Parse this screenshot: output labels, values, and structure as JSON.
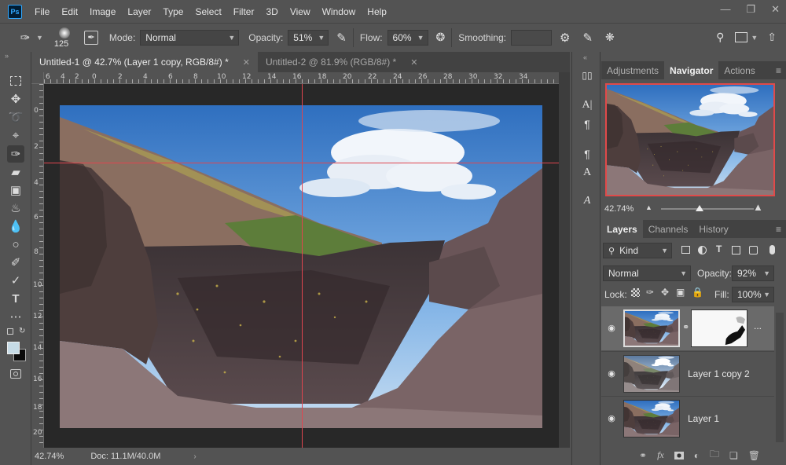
{
  "app": {
    "logo": "Ps"
  },
  "menu": [
    "File",
    "Edit",
    "Image",
    "Layer",
    "Type",
    "Select",
    "Filter",
    "3D",
    "View",
    "Window",
    "Help"
  ],
  "window_controls": [
    "minimize-icon",
    "restore-icon",
    "close-icon"
  ],
  "options": {
    "brush_size": "125",
    "mode_label": "Mode:",
    "mode_value": "Normal",
    "opacity_label": "Opacity:",
    "opacity_value": "51%",
    "flow_label": "Flow:",
    "flow_value": "60%",
    "smoothing_label": "Smoothing:",
    "smoothing_value": ""
  },
  "documents": {
    "tabs": [
      {
        "label": "Untitled-1 @ 42.7% (Layer 1 copy, RGB/8#) *",
        "active": true
      },
      {
        "label": "Untitled-2 @ 81.9% (RGB/8#) *",
        "active": false
      }
    ]
  },
  "rulers": {
    "top": [
      "6",
      "4",
      "2",
      "0",
      "2",
      "4",
      "6",
      "8",
      "10",
      "12",
      "14",
      "16",
      "18",
      "20",
      "22",
      "24",
      "26",
      "28",
      "30",
      "32",
      "34"
    ],
    "left": [
      "0",
      "2",
      "4",
      "6",
      "8",
      "10",
      "12",
      "14",
      "16",
      "18",
      "20"
    ]
  },
  "status": {
    "zoom": "42.74%",
    "doc": "Doc: 11.1M/40.0M"
  },
  "panels": {
    "top_tabs": [
      "Adjustments",
      "Navigator",
      "Actions"
    ],
    "navigator": {
      "zoom": "42.74%"
    },
    "layers_tabs": [
      "Layers",
      "Channels",
      "History"
    ],
    "kind_filter": "Kind",
    "blend_mode": "Normal",
    "opacity_label": "Opacity:",
    "opacity_value": "92%",
    "lock_label": "Lock:",
    "fill_label": "Fill:",
    "fill_value": "100%",
    "layers": [
      {
        "name": "",
        "selected": true,
        "has_mask": true
      },
      {
        "name": "Layer 1 copy 2",
        "selected": false
      },
      {
        "name": "Layer 1",
        "selected": false
      }
    ],
    "more": "..."
  },
  "colors": {
    "guide": "#e0454f",
    "panel_bg": "#535353",
    "pasteboard": "#282828",
    "accent_ps": "#31a8ff"
  }
}
